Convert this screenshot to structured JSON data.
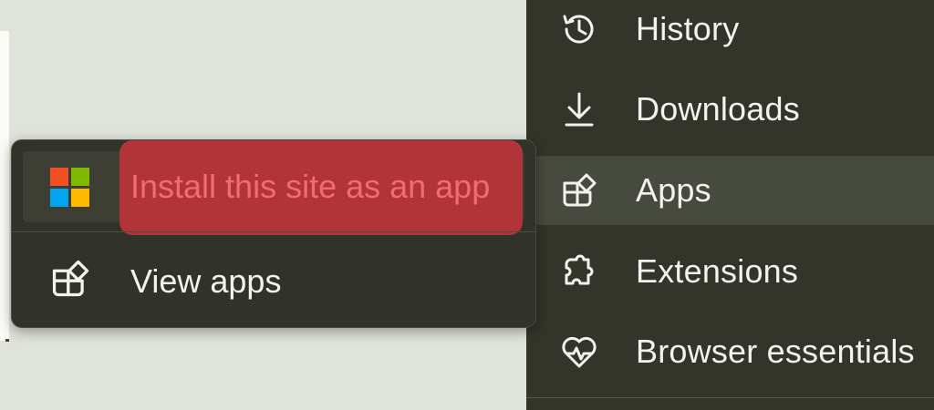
{
  "main_menu": {
    "items": [
      {
        "label": "History",
        "icon": "history-icon"
      },
      {
        "label": "Downloads",
        "icon": "download-icon"
      },
      {
        "label": "Apps",
        "icon": "apps-icon",
        "active": true
      },
      {
        "label": "Extensions",
        "icon": "extensions-icon"
      },
      {
        "label": "Browser essentials",
        "icon": "browser-essentials-icon"
      }
    ]
  },
  "apps_submenu": {
    "install_label": "Install this site as an app",
    "install_icon": "microsoft-logo-icon",
    "view_apps_label": "View apps",
    "view_apps_icon": "apps-icon"
  },
  "colors": {
    "menu_background": "#33352b",
    "highlight_red": "#b13538",
    "highlight_text": "#f06c70",
    "microsoft_red": "#f25022",
    "microsoft_green": "#7fba00",
    "microsoft_blue": "#00a4ef",
    "microsoft_yellow": "#ffb900"
  }
}
